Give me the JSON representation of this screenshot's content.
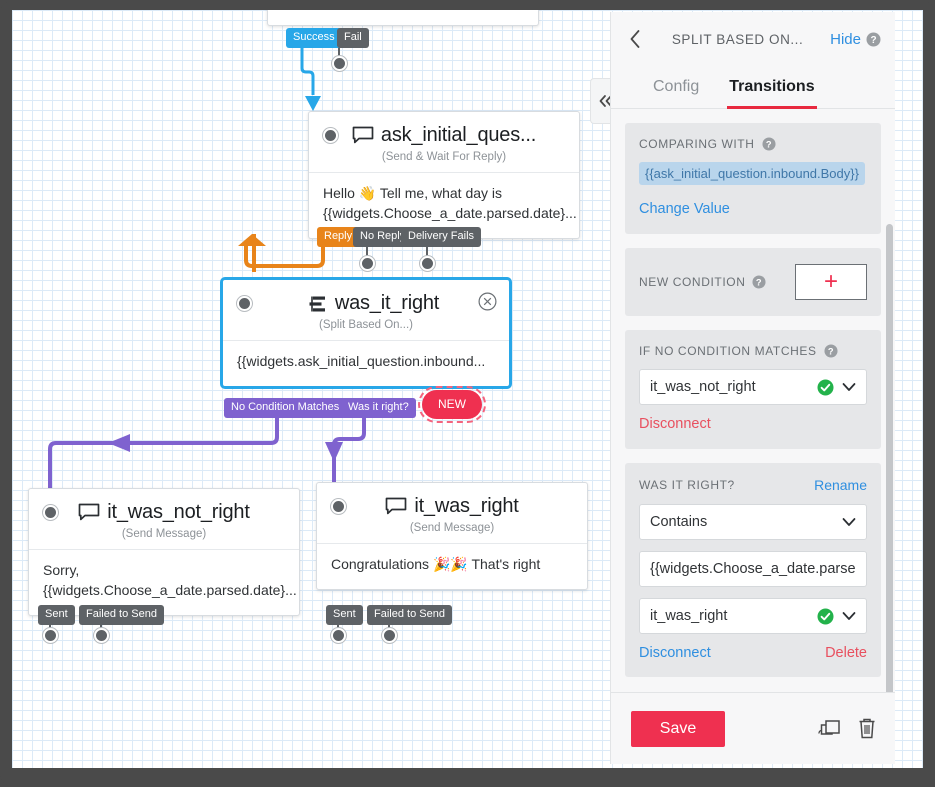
{
  "canvas": {
    "partial_node_top": {
      "name": "",
      "ports": [
        {
          "label": "Success",
          "color": "blue"
        },
        {
          "label": "Fail",
          "color": "gray"
        }
      ]
    },
    "nodes": [
      {
        "id": "ask_initial_question",
        "title": "ask_initial_ques...",
        "subtitle": "(Send & Wait For Reply)",
        "body": "Hello 👋 Tell me, what day is {{widgets.Choose_a_date.parsed.date}...",
        "icon": "message-bubble-icon",
        "ports": [
          {
            "label": "Reply",
            "color": "orange"
          },
          {
            "label": "No Reply",
            "color": "gray"
          },
          {
            "label": "Delivery Fails",
            "color": "gray"
          }
        ]
      },
      {
        "id": "was_it_right",
        "title": "was_it_right",
        "subtitle": "(Split Based On...)",
        "body": "{{widgets.ask_initial_question.inbound...",
        "icon": "split-icon",
        "selected": true,
        "ports": [
          {
            "label": "No Condition Matches",
            "color": "purple"
          },
          {
            "label": "Was it right?",
            "color": "purple"
          },
          {
            "label": "NEW",
            "color": "new"
          }
        ]
      },
      {
        "id": "it_was_not_right",
        "title": "it_was_not_right",
        "subtitle": "(Send Message)",
        "body": "Sorry, {{widgets.Choose_a_date.parsed.date}...",
        "icon": "message-bubble-icon",
        "ports": [
          {
            "label": "Sent",
            "color": "gray"
          },
          {
            "label": "Failed to Send",
            "color": "gray"
          }
        ]
      },
      {
        "id": "it_was_right",
        "title": "it_was_right",
        "subtitle": "(Send Message)",
        "body": "Congratulations 🎉🎉 That's right",
        "icon": "message-bubble-icon",
        "ports": [
          {
            "label": "Sent",
            "color": "gray"
          },
          {
            "label": "Failed to Send",
            "color": "gray"
          }
        ]
      }
    ]
  },
  "panel": {
    "title": "SPLIT BASED ON...",
    "hide_label": "Hide",
    "back_icon": "chevron-left-icon",
    "help_icon": "help-circle-icon",
    "tabs": [
      {
        "label": "Config",
        "active": false
      },
      {
        "label": "Transitions",
        "active": true
      }
    ],
    "comparing_with": {
      "label": "COMPARING WITH",
      "value": "{{ask_initial_question.inbound.Body}}",
      "change_link": "Change Value"
    },
    "new_condition": {
      "label": "NEW CONDITION",
      "add_label": "+"
    },
    "no_condition": {
      "label": "IF NO CONDITION MATCHES",
      "target": "it_was_not_right",
      "disconnect_label": "Disconnect"
    },
    "condition": {
      "label": "WAS IT RIGHT?",
      "rename_label": "Rename",
      "operator": "Contains",
      "value": "{{widgets.Choose_a_date.parse",
      "target": "it_was_right",
      "disconnect_label": "Disconnect",
      "delete_label": "Delete"
    },
    "footer": {
      "save_label": "Save",
      "duplicate_icon": "duplicate-icon",
      "delete_icon": "trash-icon"
    }
  },
  "collapse_tab": {
    "icon": "double-chevron-left-icon"
  },
  "colors": {
    "accent_red": "#ef3050",
    "link_blue": "#2f8fe0",
    "port_blue": "#28a7e8",
    "port_orange": "#e8841a",
    "port_purple": "#7f62cf",
    "port_gray": "#5e6266",
    "success_green": "#23b24b"
  }
}
